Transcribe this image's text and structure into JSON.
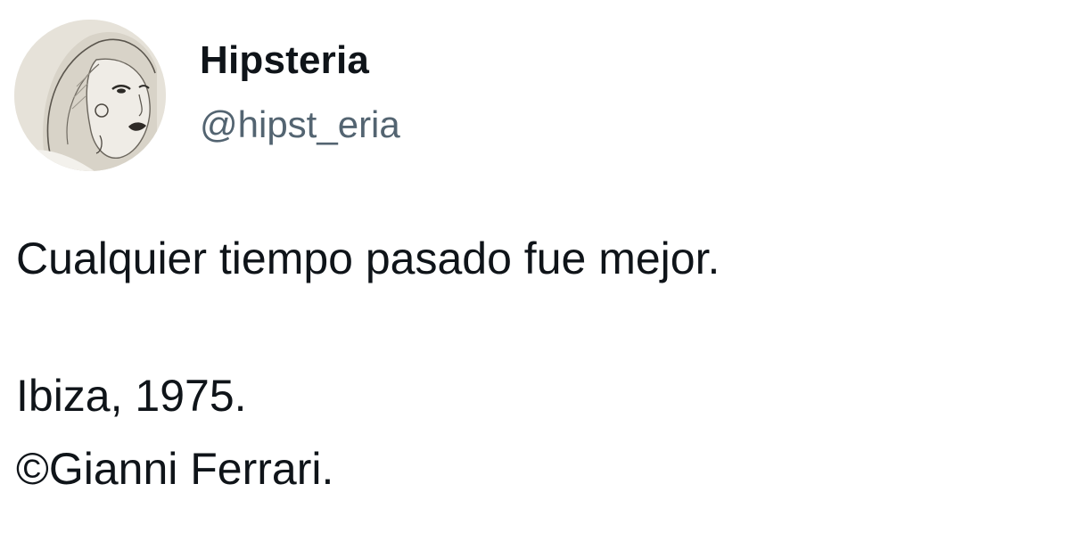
{
  "author": {
    "display_name": "Hipsteria",
    "handle": "@hipst_eria",
    "avatar_icon": "sketch-portrait-avatar"
  },
  "post": {
    "line1": "Cualquier tiempo pasado fue mejor.",
    "line2": "Ibiza, 1975.",
    "line3": "©Gianni Ferrari."
  },
  "colors": {
    "text": "#0f1419",
    "secondary": "#536471",
    "background": "#ffffff"
  }
}
